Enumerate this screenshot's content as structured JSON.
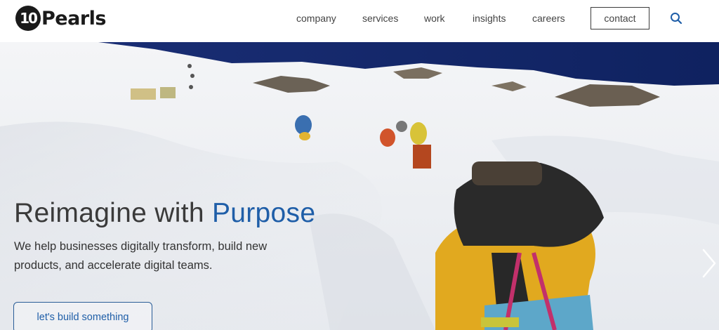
{
  "brand": {
    "logo_mark": "10",
    "logo_word": "Pearls"
  },
  "nav": {
    "items": [
      {
        "label": "company"
      },
      {
        "label": "services"
      },
      {
        "label": "work"
      },
      {
        "label": "insights"
      },
      {
        "label": "careers"
      }
    ],
    "contact_label": "contact",
    "search_icon": "search-icon"
  },
  "hero": {
    "title_plain": "Reimagine with ",
    "title_accent": "Purpose",
    "subtitle_line1": "We help businesses digitally transform, build new",
    "subtitle_line2": "products, and accelerate digital teams.",
    "cta_label": "let's build something",
    "next_icon": "chevron-right-icon"
  },
  "colors": {
    "accent": "#1f5ea8",
    "text": "#333333",
    "sky": "#15296b"
  }
}
